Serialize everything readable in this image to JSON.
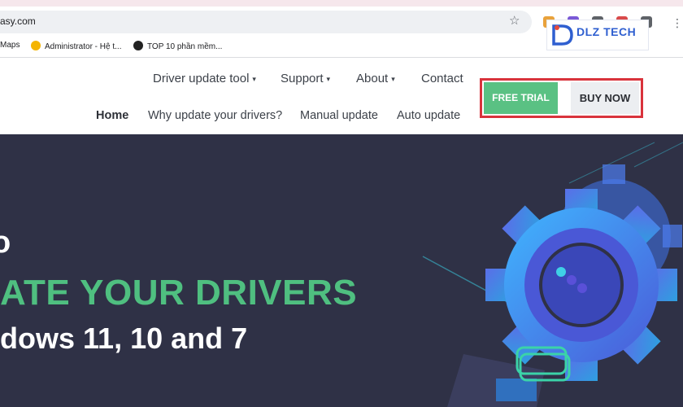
{
  "browser": {
    "url_fragment": "asy.com",
    "bookmarks": [
      {
        "label": "Maps"
      },
      {
        "label": "Administrator - Hệ t..."
      },
      {
        "label": "TOP 10 phần mềm..."
      }
    ]
  },
  "logo": {
    "text": "DLZ TECH"
  },
  "nav": {
    "top": [
      {
        "label": "Driver update tool",
        "caret": "▾"
      },
      {
        "label": "Support",
        "caret": "▾"
      },
      {
        "label": "About",
        "caret": "▾"
      },
      {
        "label": "Contact"
      }
    ],
    "secondary": [
      {
        "label": "Home"
      },
      {
        "label": "Why update your drivers?"
      },
      {
        "label": "Manual update"
      },
      {
        "label": "Auto update"
      }
    ]
  },
  "cta": {
    "free_trial": "FREE TRIAL",
    "buy_now": "BUY NOW"
  },
  "hero": {
    "line1": "o",
    "line2": "ATE YOUR DRIVERS",
    "line3": "dows 11, 10 and 7"
  },
  "colors": {
    "hero_bg": "#2f3146",
    "accent_green": "#4fbf80",
    "highlight_red": "#d9333c"
  }
}
